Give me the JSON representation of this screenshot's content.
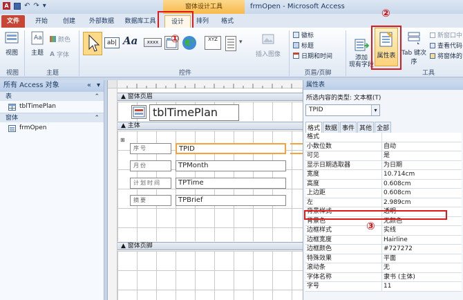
{
  "title_bar": {
    "context_tab": "窗体设计工具",
    "window_title": "frmOpen  -  Microsoft Access"
  },
  "tabs": [
    {
      "label": "文件",
      "kind": "file"
    },
    {
      "label": "开始"
    },
    {
      "label": "创建"
    },
    {
      "label": "外部数据"
    },
    {
      "label": "数据库工具"
    },
    {
      "label": "设计",
      "active": true
    },
    {
      "label": "排列"
    },
    {
      "label": "格式"
    }
  ],
  "ribbon": {
    "groups": {
      "views": "视图",
      "themes": "主题",
      "controls": "控件",
      "header_footer": "页眉/页脚",
      "tools": "工具"
    },
    "view_button": "视图",
    "theme_button": "主题",
    "colors_button": "颜色",
    "fonts_button": "字体",
    "insert_image": "插入图像",
    "logo": "徽标",
    "title": "标题",
    "date_time": "日期和时间",
    "add_existing_fields": "添加\n现有字段",
    "property_sheet": "属性表",
    "tab_order": "Tab 键次序",
    "new_window": "新窗口中",
    "view_code": "查看代码",
    "convert_macros": "将窗体的",
    "textbox_glyph": "ab|",
    "label_glyph": "Aa",
    "button_glyph": "xxxx",
    "chart_glyph": "XYZ"
  },
  "annotations": {
    "c1": "①",
    "c2": "②",
    "c3": "③"
  },
  "nav": {
    "header": "所有 Access 对象",
    "sections": [
      {
        "name": "表",
        "items": [
          "tblTimePlan"
        ]
      },
      {
        "name": "窗体",
        "items": [
          "frmOpen"
        ]
      }
    ]
  },
  "design": {
    "form_header_band": "窗体页眉",
    "header_title": "tblTimePlan",
    "detail_band": "主体",
    "form_footer_band": "窗体页脚",
    "controls": [
      {
        "label": "序号",
        "field": "TPID",
        "selected": true
      },
      {
        "label": "月份",
        "field": "TPMonth"
      },
      {
        "label": "计划时间",
        "field": "TPTime"
      },
      {
        "label": "摘要",
        "field": "TPBrief"
      }
    ]
  },
  "props": {
    "header": "属性表",
    "selection_type": "所选内容的类型: 文本框(T)",
    "selected_object": "TPID",
    "tabs": [
      "格式",
      "数据",
      "事件",
      "其他",
      "全部"
    ],
    "rows": [
      {
        "k": "格式",
        "v": ""
      },
      {
        "k": "小数位数",
        "v": "自动"
      },
      {
        "k": "可见",
        "v": "是"
      },
      {
        "k": "显示日期选取器",
        "v": "为日期"
      },
      {
        "k": "宽度",
        "v": "10.714cm"
      },
      {
        "k": "高度",
        "v": "0.608cm"
      },
      {
        "k": "上边距",
        "v": "0.608cm"
      },
      {
        "k": "左",
        "v": "2.989cm"
      },
      {
        "k": "背景样式",
        "v": "透明",
        "hl": true
      },
      {
        "k": "背景色",
        "v": "无颜色"
      },
      {
        "k": "边框样式",
        "v": "实线"
      },
      {
        "k": "边框宽度",
        "v": "Hairline"
      },
      {
        "k": "边框颜色",
        "v": "#727272"
      },
      {
        "k": "特殊效果",
        "v": "平面"
      },
      {
        "k": "滚动条",
        "v": "无"
      },
      {
        "k": "字体名称",
        "v": "隶书 (主体)"
      },
      {
        "k": "字号",
        "v": "11"
      }
    ]
  }
}
